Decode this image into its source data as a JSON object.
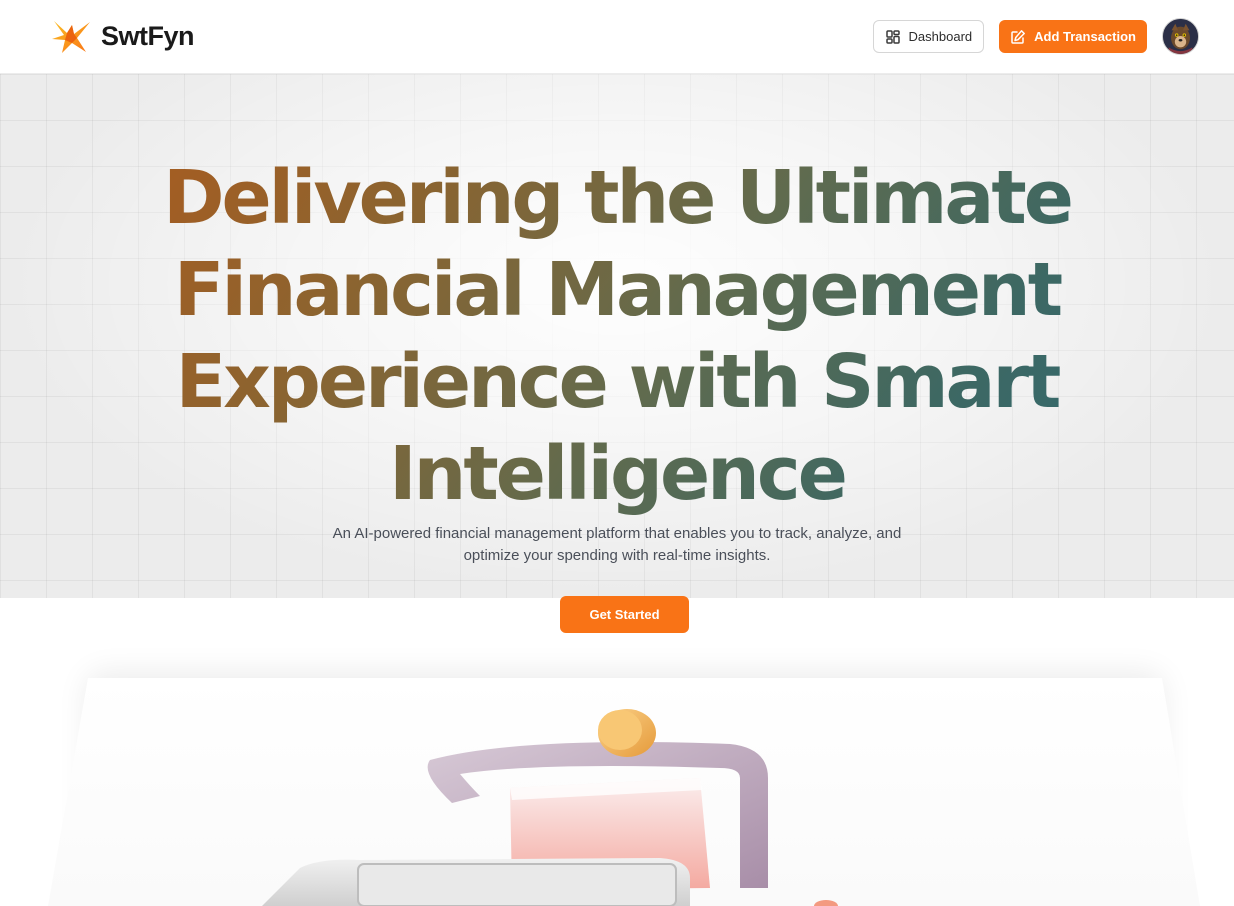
{
  "brand": {
    "name": "SwtFyn",
    "logo_icon": "star-burst-logo",
    "colors": {
      "orange": "#f97316",
      "amber": "#fbbf24"
    }
  },
  "header": {
    "dashboard_label": "Dashboard",
    "dashboard_icon": "layout-dashboard-icon",
    "add_transaction_label": "Add Transaction",
    "add_transaction_icon": "pen-square-icon",
    "avatar_icon": "user-avatar"
  },
  "hero": {
    "headline": "Delivering the Ultimate Financial Management Experience with Smart Intelligence",
    "subtitle": "An AI-powered financial management platform that enables you to track, analyze, and optimize your spending with real-time insights.",
    "cta_label": "Get Started",
    "gradient_colors": [
      "#b3591a",
      "#8b6430",
      "#5f6b4f",
      "#3d6863",
      "#2e6b78"
    ]
  },
  "preview": {
    "image_subject": "3d-coin-and-cash-register-illustration"
  }
}
